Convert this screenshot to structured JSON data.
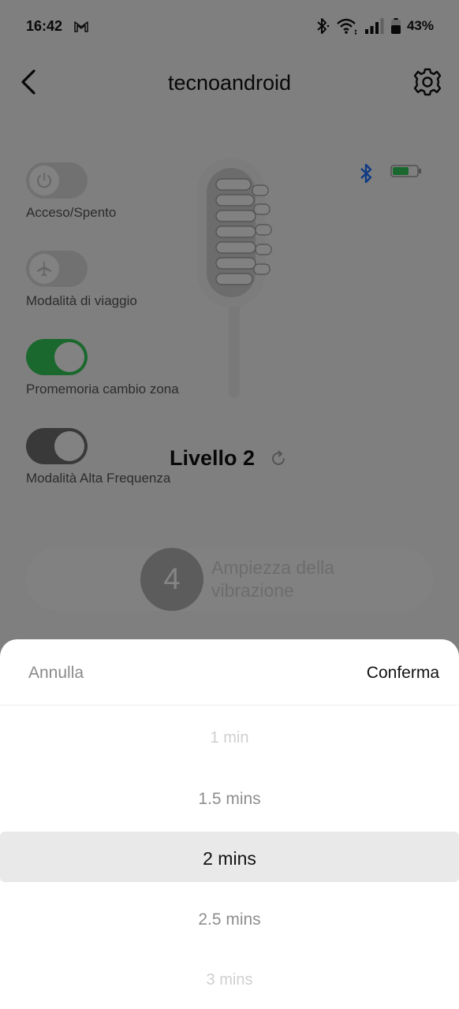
{
  "status_bar": {
    "time": "16:42",
    "battery_percent": "43%"
  },
  "header": {
    "title": "tecnoandroid"
  },
  "toggles": [
    {
      "label": "Acceso/Spento",
      "on": false,
      "icon": "power-icon"
    },
    {
      "label": "Modalità di viaggio",
      "on": false,
      "icon": "airplane-icon"
    },
    {
      "label": "Promemoria cambio zona",
      "on": true,
      "icon": ""
    },
    {
      "label": "Modalità Alta Frequenza",
      "on": true,
      "icon": ""
    }
  ],
  "level": {
    "text": "Livello 2"
  },
  "amplitude": {
    "value": "4",
    "label": "Ampiezza della vibrazione"
  },
  "sheet": {
    "cancel_label": "Annulla",
    "confirm_label": "Conferma",
    "options": [
      "1 min",
      "1.5 mins",
      "2 mins",
      "2.5 mins",
      "3 mins"
    ],
    "selected_index": 2
  },
  "colors": {
    "toggle_on": "#34c759",
    "toggle_off": "#d9d9d9",
    "bluetooth": "#1e6fff",
    "device_battery": "#34c759"
  }
}
